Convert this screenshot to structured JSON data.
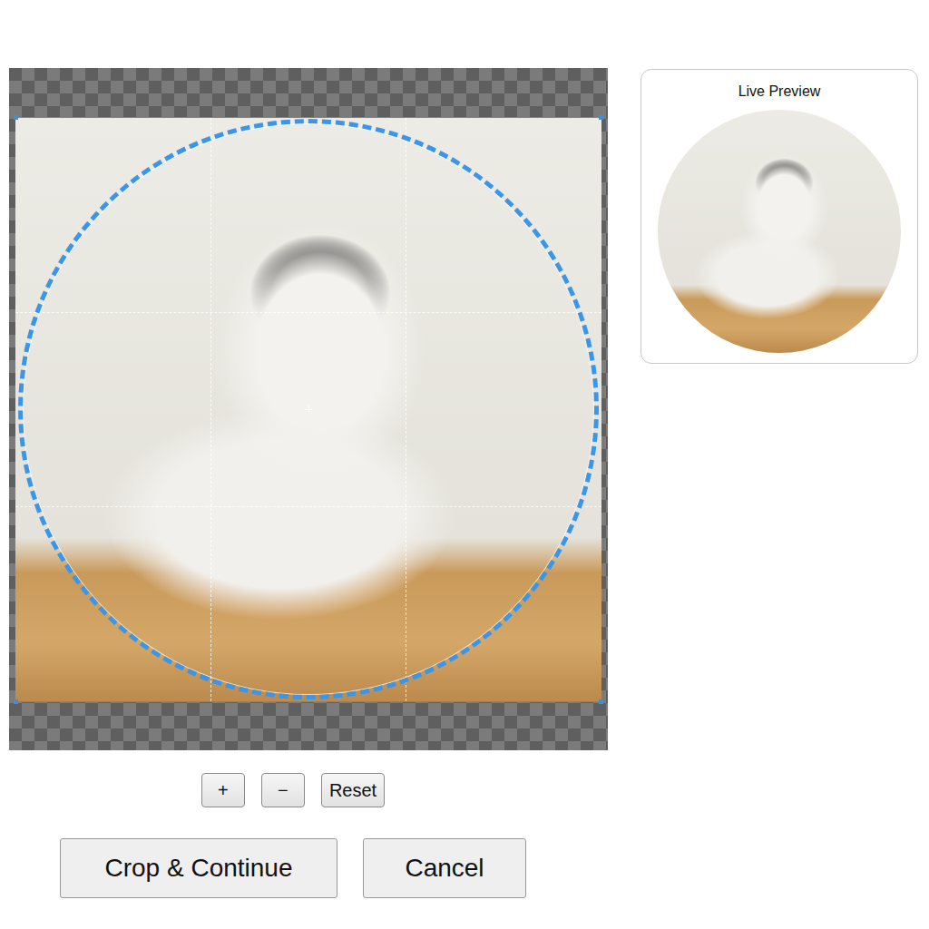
{
  "preview": {
    "title": "Live Preview"
  },
  "zoom_buttons": [
    "+",
    "−",
    "Reset"
  ],
  "actions": [
    "Crop & Continue",
    "Cancel"
  ]
}
